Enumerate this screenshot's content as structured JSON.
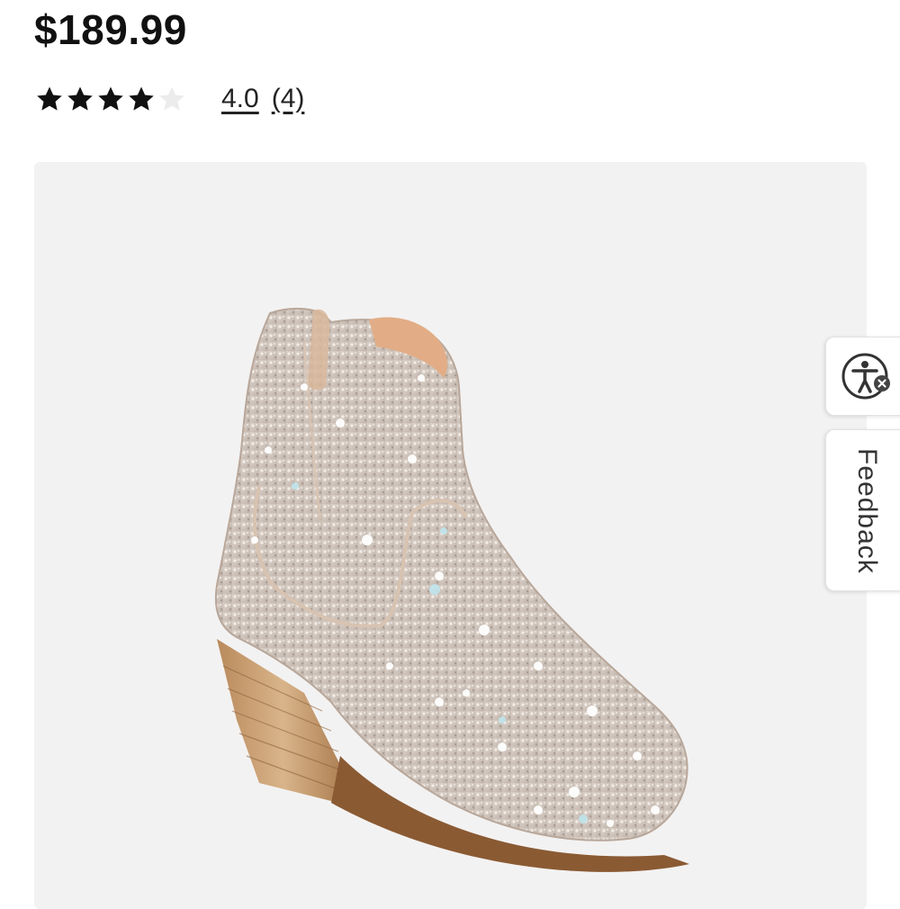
{
  "product": {
    "price": "$189.99",
    "rating": {
      "value": 4.0,
      "max": 5,
      "value_label": "4.0",
      "count_label": "(4)",
      "star_color": "#111111",
      "empty_star_color": "#e9e9e9"
    },
    "image_panel_color": "#f3f2f2"
  },
  "side_tabs": {
    "accessibility_icon": "accessibility-person-icon",
    "feedback_label": "Feedback"
  }
}
